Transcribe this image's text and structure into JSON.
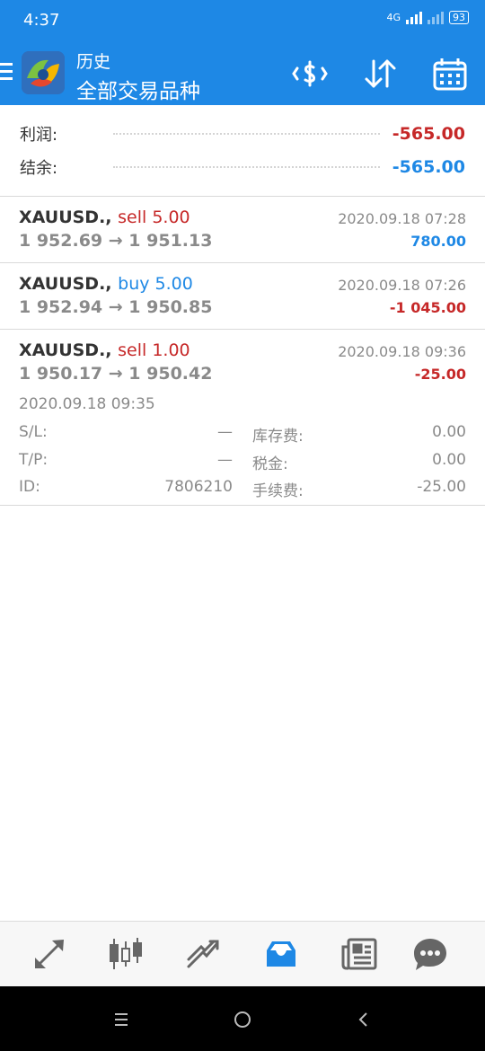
{
  "status_bar": {
    "time": "4:37",
    "network": "4G",
    "battery": "93"
  },
  "header": {
    "section": "历史",
    "title": "全部交易品种",
    "icons": [
      "menu-icon",
      "app-logo",
      "currency-exchange-icon",
      "sort-icon",
      "calendar-icon"
    ]
  },
  "summary": {
    "profit_label": "利润:",
    "profit_value": "-565.00",
    "balance_label": "结余:",
    "balance_value": "-565.00"
  },
  "trades": [
    {
      "symbol": "XAUUSD.,",
      "type": "sell 5.00",
      "prices": "1 952.69 → 1 951.13",
      "time": "2020.09.18 07:28",
      "profit": "780.00"
    },
    {
      "symbol": "XAUUSD.,",
      "type": "buy 5.00",
      "prices": "1 952.94 → 1 950.85",
      "time": "2020.09.18 07:26",
      "profit": "-1 045.00"
    },
    {
      "symbol": "XAUUSD.,",
      "type": "sell 1.00",
      "prices": "1 950.17 → 1 950.42",
      "time": "2020.09.18 09:36",
      "profit": "-25.00",
      "open_time": "2020.09.18 09:35",
      "details": {
        "sl_label": "S/L:",
        "sl_value": "—",
        "swap_label": "库存费:",
        "swap_value": "0.00",
        "tp_label": "T/P:",
        "tp_value": "—",
        "tax_label": "税金:",
        "tax_value": "0.00",
        "id_label": "ID:",
        "id_value": "7806210",
        "fee_label": "手续费:",
        "fee_value": "-25.00"
      }
    }
  ],
  "bottom_nav": [
    "quotes-icon",
    "chart-icon",
    "trade-icon",
    "history-icon",
    "news-icon",
    "chat-icon"
  ],
  "colors": {
    "primary": "#1e88e5",
    "sell": "#c62828",
    "buy": "#1e88e5",
    "negative": "#c62828",
    "positive": "#1e88e5"
  }
}
